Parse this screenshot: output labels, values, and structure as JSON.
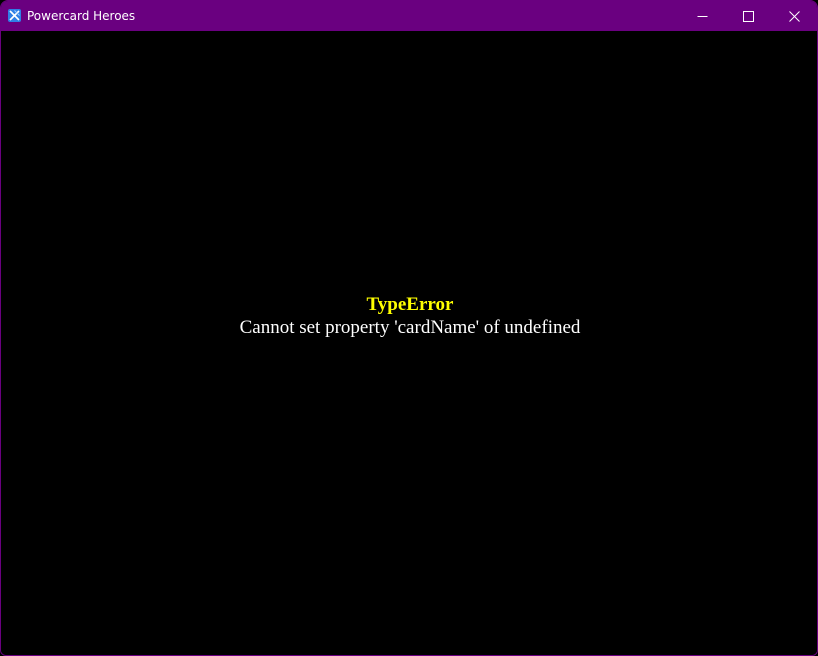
{
  "window": {
    "title": "Powercard Heroes",
    "titlebar_color": "#6a0080",
    "icon": "app-icon",
    "controls": {
      "minimize_icon": "minimize-icon",
      "maximize_icon": "maximize-icon",
      "close_icon": "close-icon"
    }
  },
  "error": {
    "type": "TypeError",
    "message": "Cannot set property 'cardName' of undefined",
    "type_color": "#ffff00",
    "message_color": "#ffffff"
  }
}
